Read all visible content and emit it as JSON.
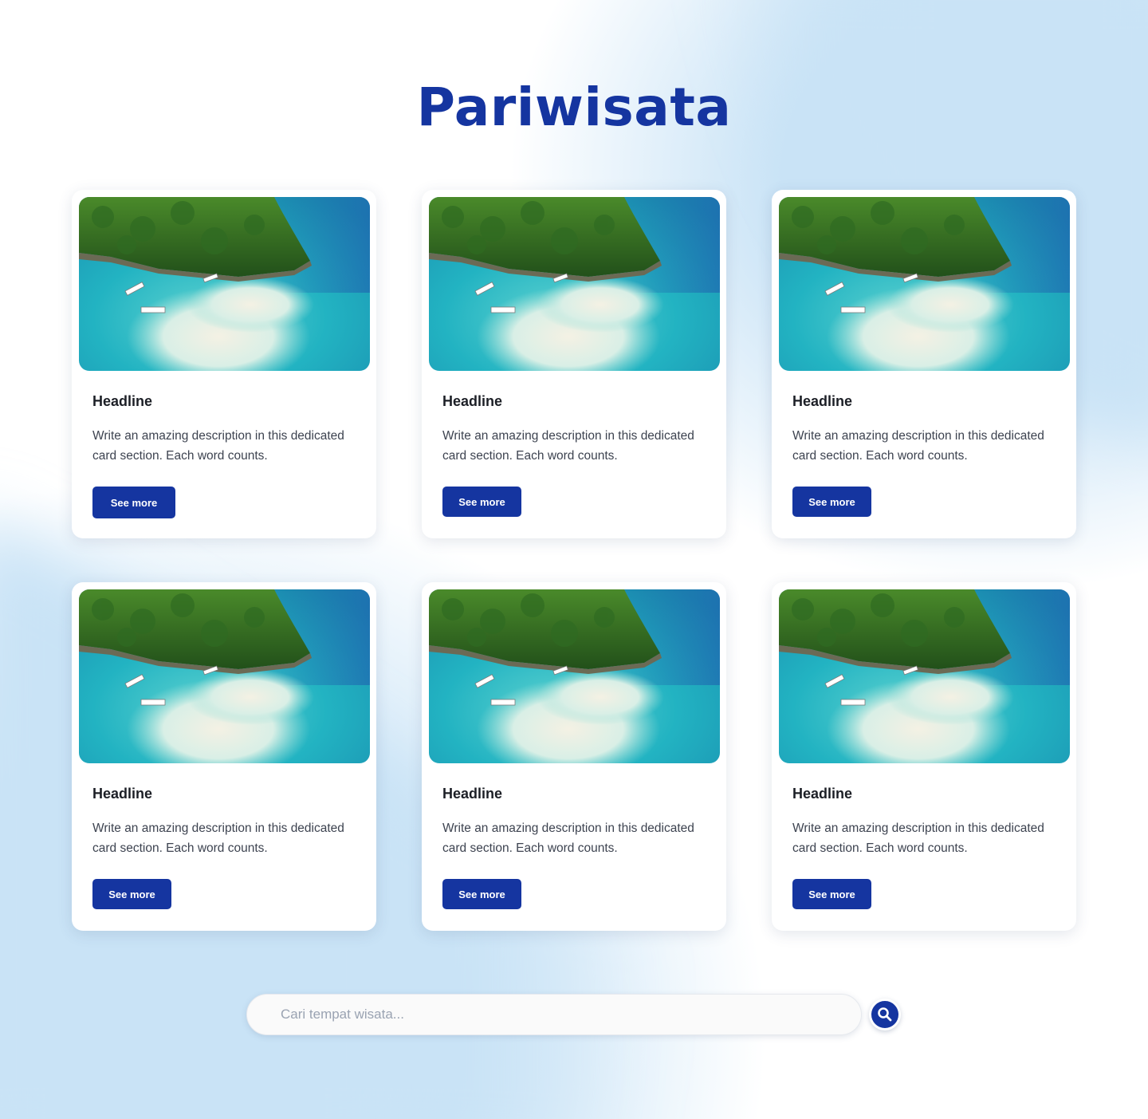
{
  "page": {
    "title": "Pariwisata"
  },
  "cards": [
    {
      "headline": "Headline",
      "description": "Write an amazing description in this dedicated card section. Each word counts.",
      "button": "See more"
    },
    {
      "headline": "Headline",
      "description": "Write an amazing description in this dedicated card section. Each word counts.",
      "button": "See more"
    },
    {
      "headline": "Headline",
      "description": "Write an amazing description in this dedicated card section. Each word counts.",
      "button": "See more"
    },
    {
      "headline": "Headline",
      "description": "Write an amazing description in this dedicated card section. Each word counts.",
      "button": "See more"
    },
    {
      "headline": "Headline",
      "description": "Write an amazing description in this dedicated card section. Each word counts.",
      "button": "See more"
    },
    {
      "headline": "Headline",
      "description": "Write an amazing description in this dedicated card section. Each word counts.",
      "button": "See more"
    }
  ],
  "search": {
    "placeholder": "Cari tempat wisata...",
    "value": "",
    "button_icon": "search-icon"
  },
  "colors": {
    "primary": "#1535a0",
    "background_accent": "#c9e3f6",
    "card_background": "#ffffff"
  }
}
